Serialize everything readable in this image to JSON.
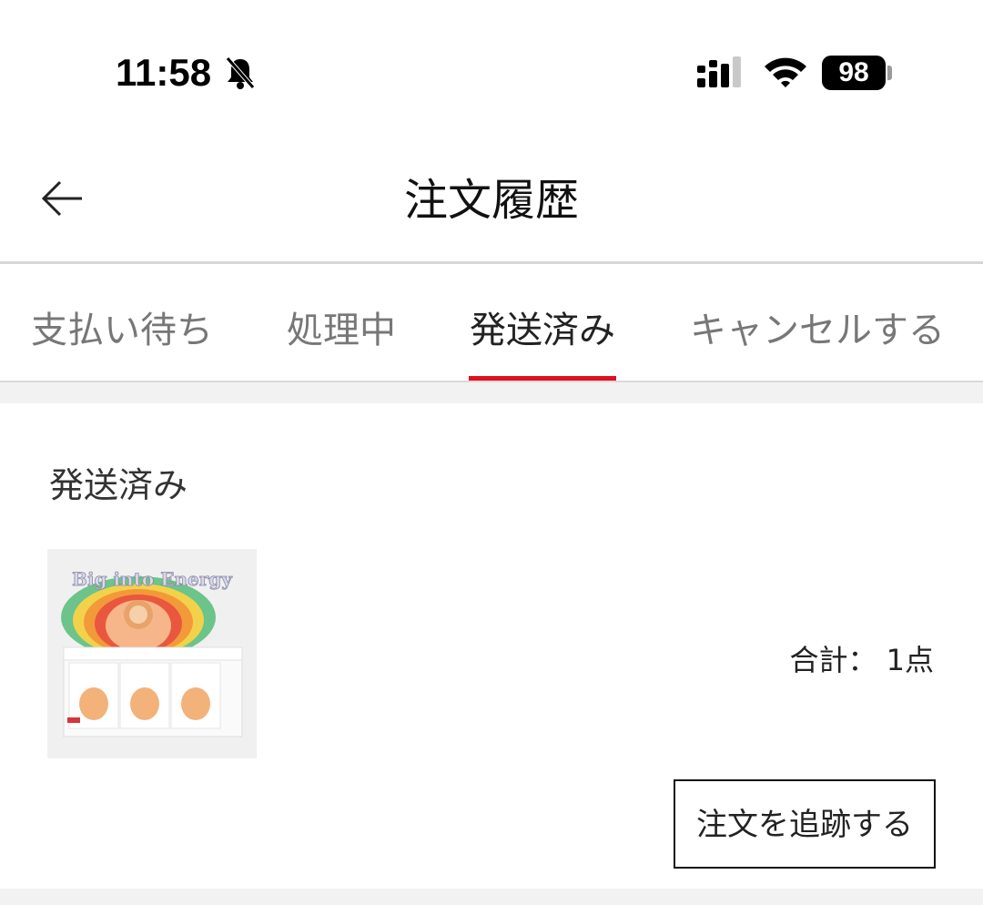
{
  "status_bar": {
    "time": "11:58",
    "battery": "98",
    "icons": [
      "bell-slash-icon",
      "cellular-signal-icon",
      "wifi-icon",
      "battery-icon"
    ]
  },
  "header": {
    "title": "注文履歴",
    "back_icon": "arrow-left-icon"
  },
  "tabs": [
    {
      "label": "支払い待ち",
      "active": false
    },
    {
      "label": "処理中",
      "active": false
    },
    {
      "label": "発送済み",
      "active": true
    },
    {
      "label": "キャンセルする",
      "active": false
    }
  ],
  "order": {
    "status": "発送済み",
    "product_image_text": "Big into Energy",
    "total": "合計： 1点",
    "track_button": "注文を追跡する"
  },
  "colors": {
    "accent": "#e0101e",
    "text": "#222222",
    "muted": "#777777",
    "divider": "#d9d9d9"
  }
}
